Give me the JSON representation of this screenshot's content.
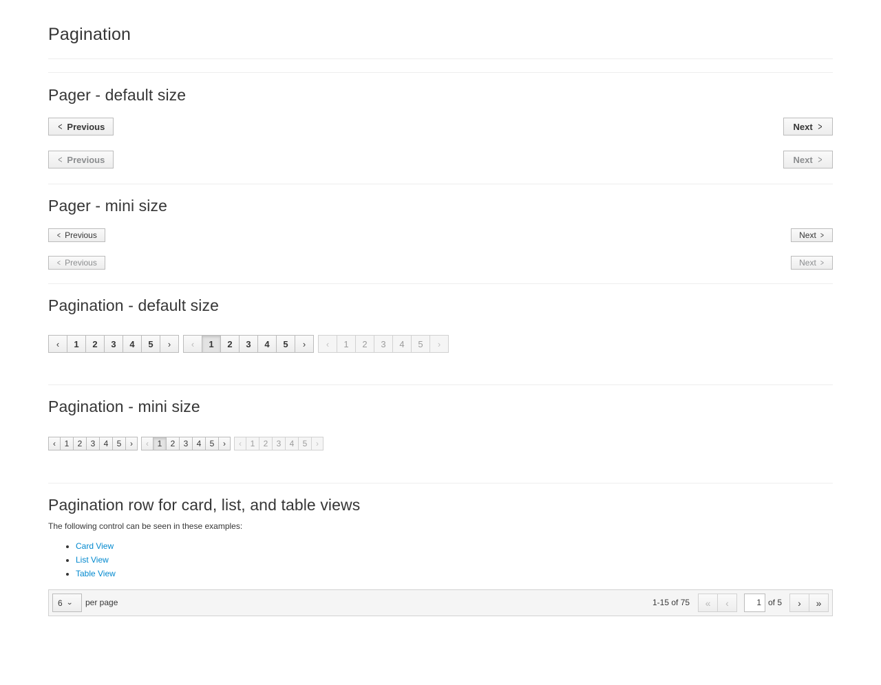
{
  "title": "Pagination",
  "pager_default": {
    "heading": "Pager - default size",
    "previous": "Previous",
    "next": "Next"
  },
  "pager_mini": {
    "heading": "Pager - mini size",
    "previous": "Previous",
    "next": "Next"
  },
  "pagination_default": {
    "heading": "Pagination - default size",
    "prev_icon": "‹",
    "next_icon": "›",
    "pages": [
      "1",
      "2",
      "3",
      "4",
      "5"
    ]
  },
  "pagination_mini": {
    "heading": "Pagination - mini size",
    "prev_icon": "‹",
    "next_icon": "›",
    "pages": [
      "1",
      "2",
      "3",
      "4",
      "5"
    ]
  },
  "pagination_row": {
    "heading": "Pagination row for card, list, and table views",
    "intro": "The following control can be seen in these examples:",
    "links": [
      "Card View",
      "List View",
      "Table View"
    ],
    "per_page_value": "6",
    "per_page_label": "per page",
    "range": "1-15 of 75",
    "current_page": "1",
    "of_pages": "of 5"
  }
}
